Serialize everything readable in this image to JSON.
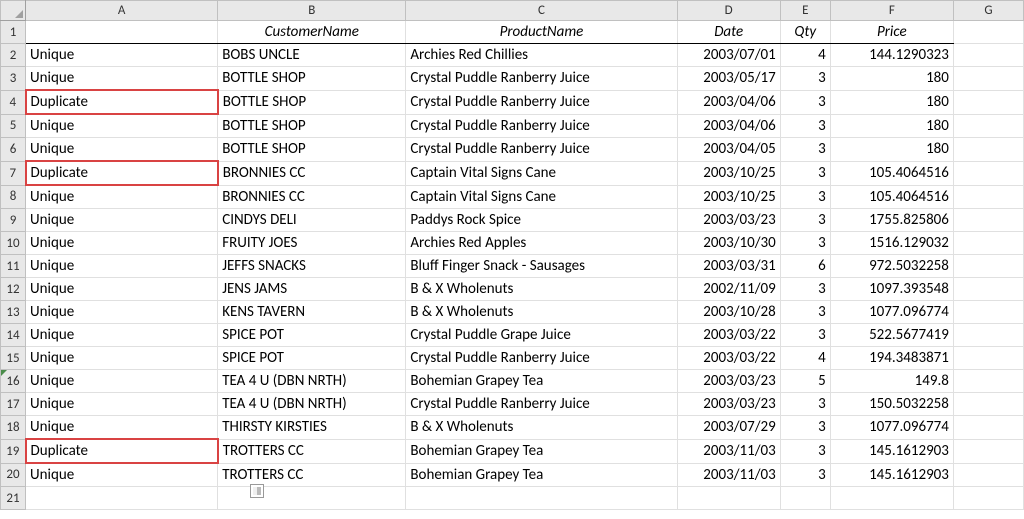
{
  "columns": [
    "A",
    "B",
    "C",
    "D",
    "E",
    "F",
    "G"
  ],
  "row_numbers": [
    1,
    2,
    3,
    4,
    5,
    6,
    7,
    8,
    9,
    10,
    11,
    12,
    13,
    14,
    15,
    16,
    17,
    18,
    19,
    20,
    21
  ],
  "headers": {
    "customer": "CustomerName",
    "product": "ProductName",
    "date": "Date",
    "qty": "Qty",
    "price": "Price"
  },
  "rows": [
    {
      "status": "Unique",
      "customer": "BOBS UNCLE",
      "product": "Archies Red Chillies",
      "date": "2003/07/01",
      "qty": "4",
      "price": "144.1290323",
      "dup": false
    },
    {
      "status": "Unique",
      "customer": "BOTTLE SHOP",
      "product": "Crystal Puddle Ranberry Juice",
      "date": "2003/05/17",
      "qty": "3",
      "price": "180",
      "dup": false
    },
    {
      "status": "Duplicate",
      "customer": "BOTTLE SHOP",
      "product": "Crystal Puddle Ranberry Juice",
      "date": "2003/04/06",
      "qty": "3",
      "price": "180",
      "dup": true
    },
    {
      "status": "Unique",
      "customer": "BOTTLE SHOP",
      "product": "Crystal Puddle Ranberry Juice",
      "date": "2003/04/06",
      "qty": "3",
      "price": "180",
      "dup": false
    },
    {
      "status": "Unique",
      "customer": "BOTTLE SHOP",
      "product": "Crystal Puddle Ranberry Juice",
      "date": "2003/04/05",
      "qty": "3",
      "price": "180",
      "dup": false
    },
    {
      "status": "Duplicate",
      "customer": "BRONNIES  CC",
      "product": "Captain Vital Signs Cane",
      "date": "2003/10/25",
      "qty": "3",
      "price": "105.4064516",
      "dup": true
    },
    {
      "status": "Unique",
      "customer": "BRONNIES  CC",
      "product": "Captain Vital Signs Cane",
      "date": "2003/10/25",
      "qty": "3",
      "price": "105.4064516",
      "dup": false
    },
    {
      "status": "Unique",
      "customer": "CINDYS DELI",
      "product": "Paddys Rock Spice",
      "date": "2003/03/23",
      "qty": "3",
      "price": "1755.825806",
      "dup": false
    },
    {
      "status": "Unique",
      "customer": "FRUITY JOES",
      "product": "Archies Red Apples",
      "date": "2003/10/30",
      "qty": "3",
      "price": "1516.129032",
      "dup": false
    },
    {
      "status": "Unique",
      "customer": "JEFFS SNACKS",
      "product": "Bluff Finger Snack - Sausages",
      "date": "2003/03/31",
      "qty": "6",
      "price": "972.5032258",
      "dup": false
    },
    {
      "status": "Unique",
      "customer": "JENS JAMS",
      "product": "B & X Wholenuts",
      "date": "2002/11/09",
      "qty": "3",
      "price": "1097.393548",
      "dup": false
    },
    {
      "status": "Unique",
      "customer": "KENS TAVERN",
      "product": "B & X Wholenuts",
      "date": "2003/10/28",
      "qty": "3",
      "price": "1077.096774",
      "dup": false
    },
    {
      "status": "Unique",
      "customer": "SPICE POT",
      "product": "Crystal Puddle Grape Juice",
      "date": "2003/03/22",
      "qty": "3",
      "price": "522.5677419",
      "dup": false
    },
    {
      "status": "Unique",
      "customer": "SPICE POT",
      "product": "Crystal Puddle Ranberry Juice",
      "date": "2003/03/22",
      "qty": "4",
      "price": "194.3483871",
      "dup": false
    },
    {
      "status": "Unique",
      "customer": "TEA 4 U (DBN NRTH)",
      "product": "Bohemian Grapey Tea",
      "date": "2003/03/23",
      "qty": "5",
      "price": "149.8",
      "dup": false
    },
    {
      "status": "Unique",
      "customer": "TEA 4 U (DBN NRTH)",
      "product": "Crystal Puddle Ranberry Juice",
      "date": "2003/03/23",
      "qty": "3",
      "price": "150.5032258",
      "dup": false
    },
    {
      "status": "Unique",
      "customer": "THIRSTY KIRSTIES",
      "product": "B & X Wholenuts",
      "date": "2003/07/29",
      "qty": "3",
      "price": "1077.096774",
      "dup": false
    },
    {
      "status": "Duplicate",
      "customer": "TROTTERS CC",
      "product": "Bohemian Grapey Tea",
      "date": "2003/11/03",
      "qty": "3",
      "price": "145.1612903",
      "dup": true
    },
    {
      "status": "Unique",
      "customer": "TROTTERS CC",
      "product": "Bohemian Grapey Tea",
      "date": "2003/11/03",
      "qty": "3",
      "price": "145.1612903",
      "dup": false
    }
  ]
}
